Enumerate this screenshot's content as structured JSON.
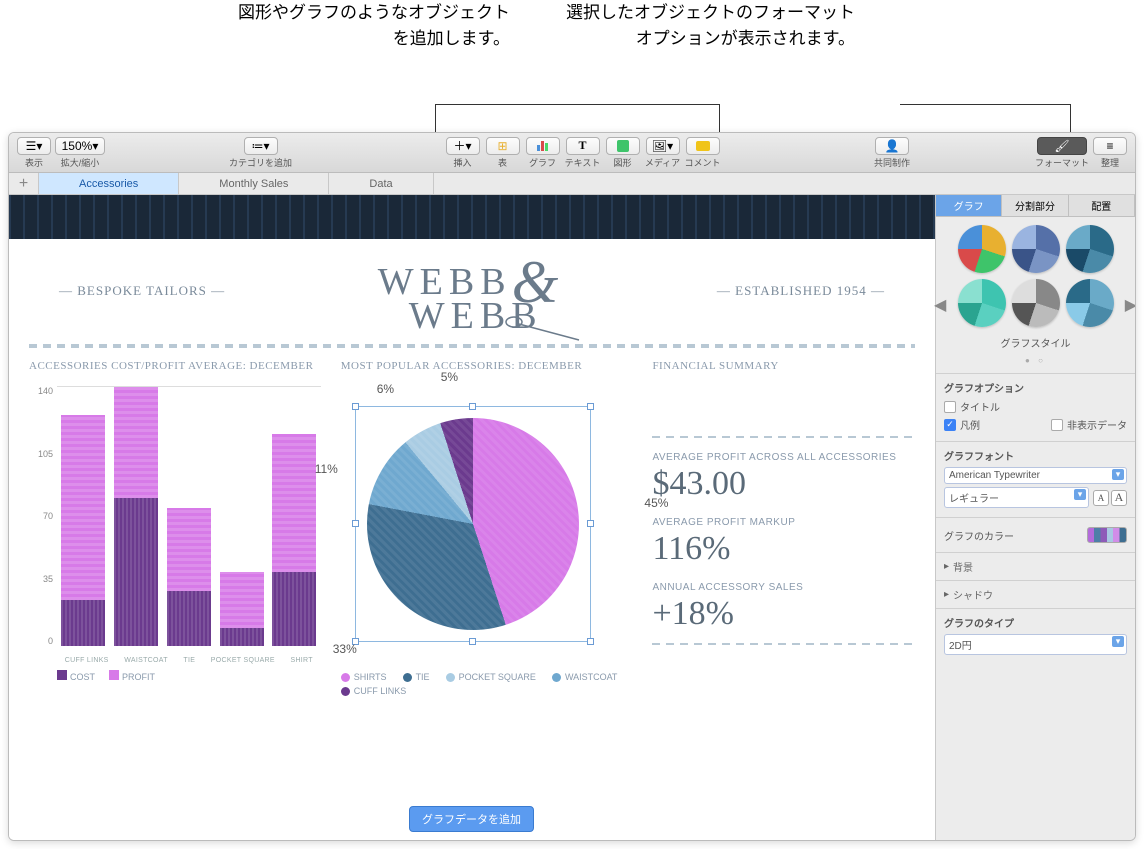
{
  "callouts": {
    "insert": "図形やグラフのようなオブジェクトを追加します。",
    "format": "選択したオブジェクトのフォーマットオプションが表示されます。"
  },
  "toolbar": {
    "view": "表示",
    "zoom": "拡大/縮小",
    "zoom_value": "150%",
    "category": "カテゴリを追加",
    "insert": "挿入",
    "table": "表",
    "chart": "グラフ",
    "text": "テキスト",
    "shape": "図形",
    "media": "メディア",
    "comment": "コメント",
    "collaborate": "共同制作",
    "format": "フォーマット",
    "organize": "整理"
  },
  "tabs": [
    "Accessories",
    "Monthly Sales",
    "Data"
  ],
  "active_tab": 0,
  "doc": {
    "tag_left": "— BESPOKE TAILORS —",
    "tag_right": "— ESTABLISHED 1954 —",
    "logo_line1": "WEBB",
    "logo_line2": "WEBB",
    "amp": "&",
    "bar_title": "ACCESSORIES COST/PROFIT AVERAGE: DECEMBER",
    "pie_title": "MOST POPULAR ACCESSORIES: DECEMBER",
    "sum_title": "FINANCIAL SUMMARY",
    "sum1_label": "AVERAGE PROFIT ACROSS ALL ACCESSORIES",
    "sum1_value": "$43.00",
    "sum2_label": "AVERAGE PROFIT MARKUP",
    "sum2_value": "116%",
    "sum3_label": "ANNUAL ACCESSORY SALES",
    "sum3_value": "+18%",
    "add_data": "グラフデータを追加"
  },
  "bar_legend": {
    "cost": "COST",
    "profit": "PROFIT"
  },
  "pie_legend": [
    "SHIRTS",
    "TIE",
    "POCKET SQUARE",
    "WAISTCOAT",
    "CUFF LINKS"
  ],
  "inspector": {
    "tabs": [
      "グラフ",
      "分割部分",
      "配置"
    ],
    "active_tab": 0,
    "style_label": "グラフスタイル",
    "options_h": "グラフオプション",
    "title_cb": "タイトル",
    "legend_cb": "凡例",
    "hidden_cb": "非表示データ",
    "font_h": "グラフフォント",
    "font_name": "American Typewriter",
    "font_weight": "レギュラー",
    "color_h": "グラフのカラー",
    "bg_h": "背景",
    "shadow_h": "シャドウ",
    "type_h": "グラフのタイプ",
    "type_val": "2D円"
  },
  "chart_data": [
    {
      "type": "bar",
      "title": "ACCESSORIES COST/PROFIT AVERAGE: DECEMBER",
      "categories": [
        "CUFF LINKS",
        "WAISTCOAT",
        "TIE",
        "POCKET SQUARE",
        "SHIRT"
      ],
      "series": [
        {
          "name": "COST",
          "values": [
            25,
            80,
            30,
            10,
            40
          ]
        },
        {
          "name": "PROFIT",
          "values": [
            100,
            60,
            45,
            30,
            75
          ]
        }
      ],
      "ylim": [
        0,
        140
      ],
      "yticks": [
        0,
        35,
        70,
        105,
        140
      ]
    },
    {
      "type": "pie",
      "title": "MOST POPULAR ACCESSORIES: DECEMBER",
      "categories": [
        "SHIRTS",
        "WAISTCOAT",
        "TIE",
        "POCKET SQUARE",
        "CUFF LINKS"
      ],
      "values": [
        45,
        33,
        11,
        6,
        5
      ],
      "value_suffix": "%"
    }
  ]
}
